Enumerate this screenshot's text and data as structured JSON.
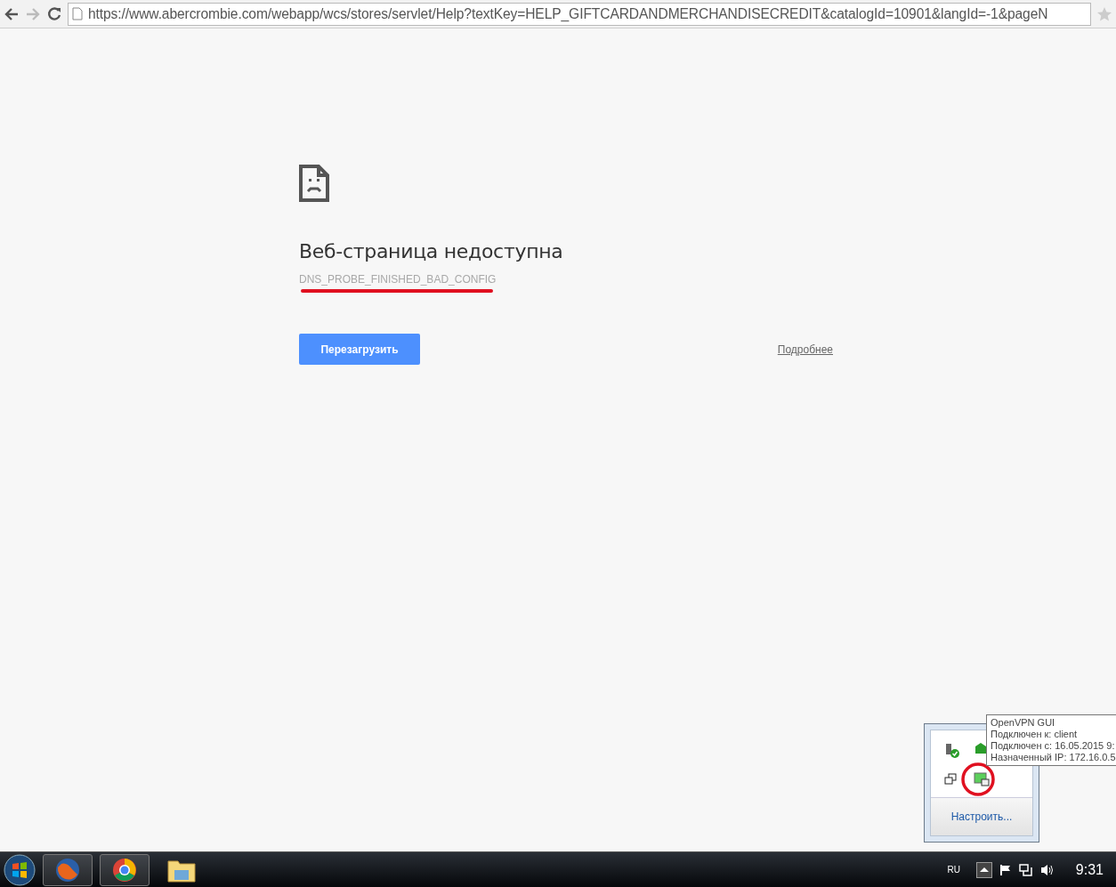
{
  "browser": {
    "url": "https://www.abercrombie.com/webapp/wcs/stores/servlet/Help?textKey=HELP_GIFTCARDANDMERCHANDISECREDIT&catalogId=10901&langId=-1&pageN"
  },
  "error_page": {
    "title": "Веб-страница недоступна",
    "code": "DNS_PROBE_FINISHED_BAD_CONFIG",
    "reload_button": "Перезагрузить",
    "details_link": "Подробнее"
  },
  "tray_popup": {
    "settings_link": "Настроить..."
  },
  "tooltip": {
    "lines": [
      "OpenVPN GUI",
      "Подключен к: client",
      "Подключен с: 16.05.2015 9:",
      "Назначенный IP: 172.16.0.5"
    ]
  },
  "taskbar": {
    "language": "RU",
    "clock": "9:31"
  }
}
